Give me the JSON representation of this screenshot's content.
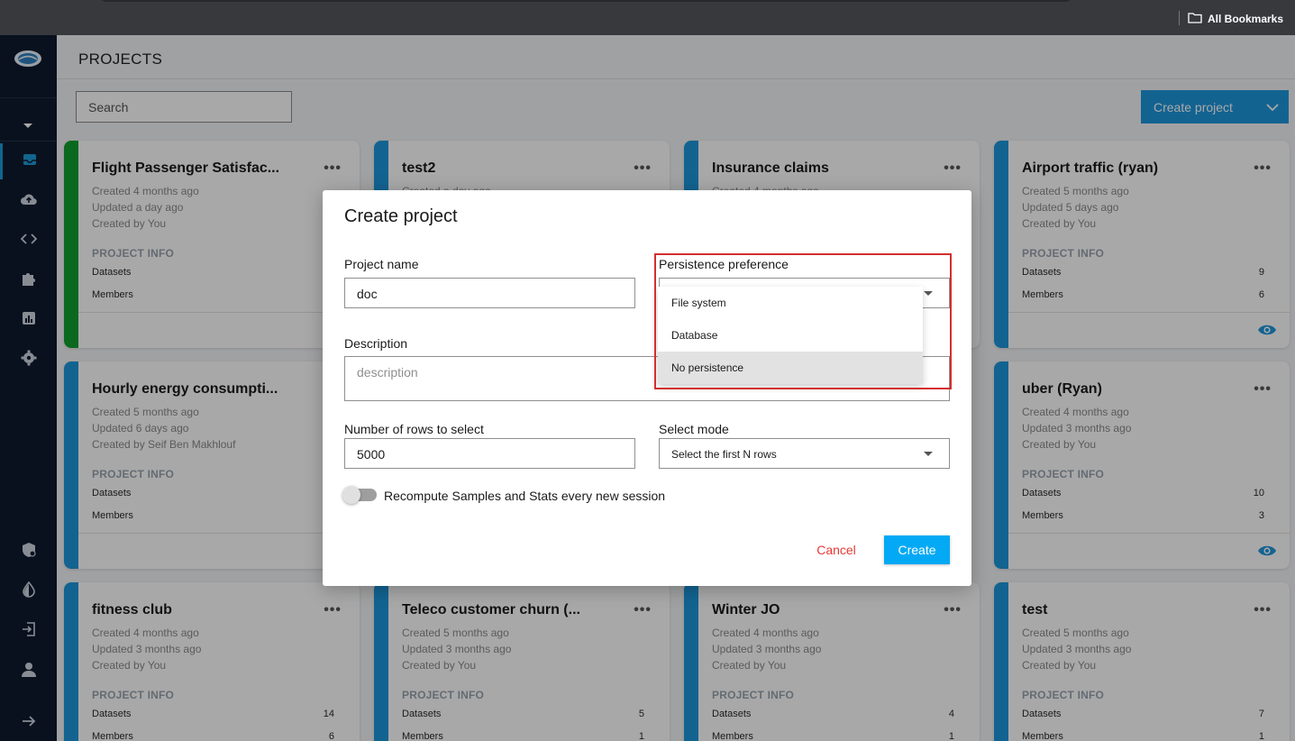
{
  "browser": {
    "bookmarks_label": "All Bookmarks"
  },
  "sidebar": {
    "icons": [
      "logo-icon",
      "caret-down-icon",
      "inbox-icon",
      "cloud-upload-icon",
      "code-icon",
      "puzzle-icon",
      "chart-icon",
      "gear-icon",
      "shield-icon",
      "contrast-icon",
      "logout-icon",
      "user-icon",
      "arrow-right-icon"
    ]
  },
  "header": {
    "title": "PROJECTS",
    "search_placeholder": "Search",
    "create_button": "Create project"
  },
  "cards": [
    {
      "name": "Flight Passenger Satisfac...",
      "created": "Created 4 months ago",
      "updated": "Updated a day ago",
      "by": "Created by You",
      "info": "PROJECT INFO",
      "datasets_label": "Datasets",
      "members_label": "Members",
      "datasets": "",
      "members": "",
      "stripe": "#12a02f"
    },
    {
      "name": "test2",
      "created": "Created a day ago",
      "updated": "",
      "by": "",
      "info": "",
      "datasets_label": "",
      "members_label": "",
      "datasets": "",
      "members": "",
      "stripe": "#1e96dc"
    },
    {
      "name": "Insurance claims",
      "created": "Created 4 months ago",
      "updated": "",
      "by": "",
      "info": "",
      "datasets_label": "",
      "members_label": "",
      "datasets": "",
      "members": "",
      "stripe": "#1e96dc"
    },
    {
      "name": "Airport traffic (ryan)",
      "created": "Created 5 months ago",
      "updated": "Updated 5 days ago",
      "by": "Created by You",
      "info": "PROJECT INFO",
      "datasets_label": "Datasets",
      "members_label": "Members",
      "datasets": "9",
      "members": "6",
      "stripe": "#1e96dc"
    },
    {
      "name": "Hourly energy consumpti...",
      "created": "Created 5 months ago",
      "updated": "Updated 6 days ago",
      "by": "Created by Seif Ben Makhlouf",
      "info": "PROJECT INFO",
      "datasets_label": "Datasets",
      "members_label": "Members",
      "datasets": "",
      "members": "",
      "stripe": "#1e96dc"
    },
    {
      "name": "uber (Ryan)",
      "created": "Created 4 months ago",
      "updated": "Updated 3 months ago",
      "by": "Created by You",
      "info": "PROJECT INFO",
      "datasets_label": "Datasets",
      "members_label": "Members",
      "datasets": "10",
      "members": "3",
      "stripe": "#1e96dc"
    },
    {
      "name": "fitness club",
      "created": "Created 4 months ago",
      "updated": "Updated 3 months ago",
      "by": "Created by You",
      "info": "PROJECT INFO",
      "datasets_label": "Datasets",
      "members_label": "Members",
      "datasets": "14",
      "members": "6",
      "stripe": "#1e96dc"
    },
    {
      "name": "Teleco customer churn (...",
      "created": "Created 5 months ago",
      "updated": "Updated 3 months ago",
      "by": "Created by You",
      "info": "PROJECT INFO",
      "datasets_label": "Datasets",
      "members_label": "Members",
      "datasets": "5",
      "members": "1",
      "stripe": "#1e96dc"
    },
    {
      "name": "Winter JO",
      "created": "Created 4 months ago",
      "updated": "Updated 3 months ago",
      "by": "Created by You",
      "info": "PROJECT INFO",
      "datasets_label": "Datasets",
      "members_label": "Members",
      "datasets": "4",
      "members": "1",
      "stripe": "#1e96dc"
    },
    {
      "name": "test",
      "created": "Created 5 months ago",
      "updated": "Updated 3 months ago",
      "by": "Created by You",
      "info": "PROJECT INFO",
      "datasets_label": "Datasets",
      "members_label": "Members",
      "datasets": "7",
      "members": "1",
      "stripe": "#1e96dc"
    }
  ],
  "modal": {
    "title": "Create project",
    "project_name_label": "Project name",
    "project_name_value": "doc",
    "persistence_label": "Persistence preference",
    "persistence_options": [
      "File system",
      "Database",
      "No persistence"
    ],
    "persistence_highlighted": "No persistence",
    "description_label": "Description",
    "description_placeholder": "description",
    "rows_label": "Number of rows to select",
    "rows_value": "5000",
    "select_mode_label": "Select mode",
    "select_mode_value": "Select the first N rows",
    "recompute_label": "Recompute Samples and Stats every new session",
    "recompute_enabled": false,
    "cancel_label": "Cancel",
    "create_label": "Create"
  },
  "colors": {
    "accent": "#1e96dc",
    "create_button": "#03a9f4",
    "cancel_text": "#e53935",
    "highlight_border": "#d32f2f",
    "sidebar_bg": "#0f1b30"
  }
}
